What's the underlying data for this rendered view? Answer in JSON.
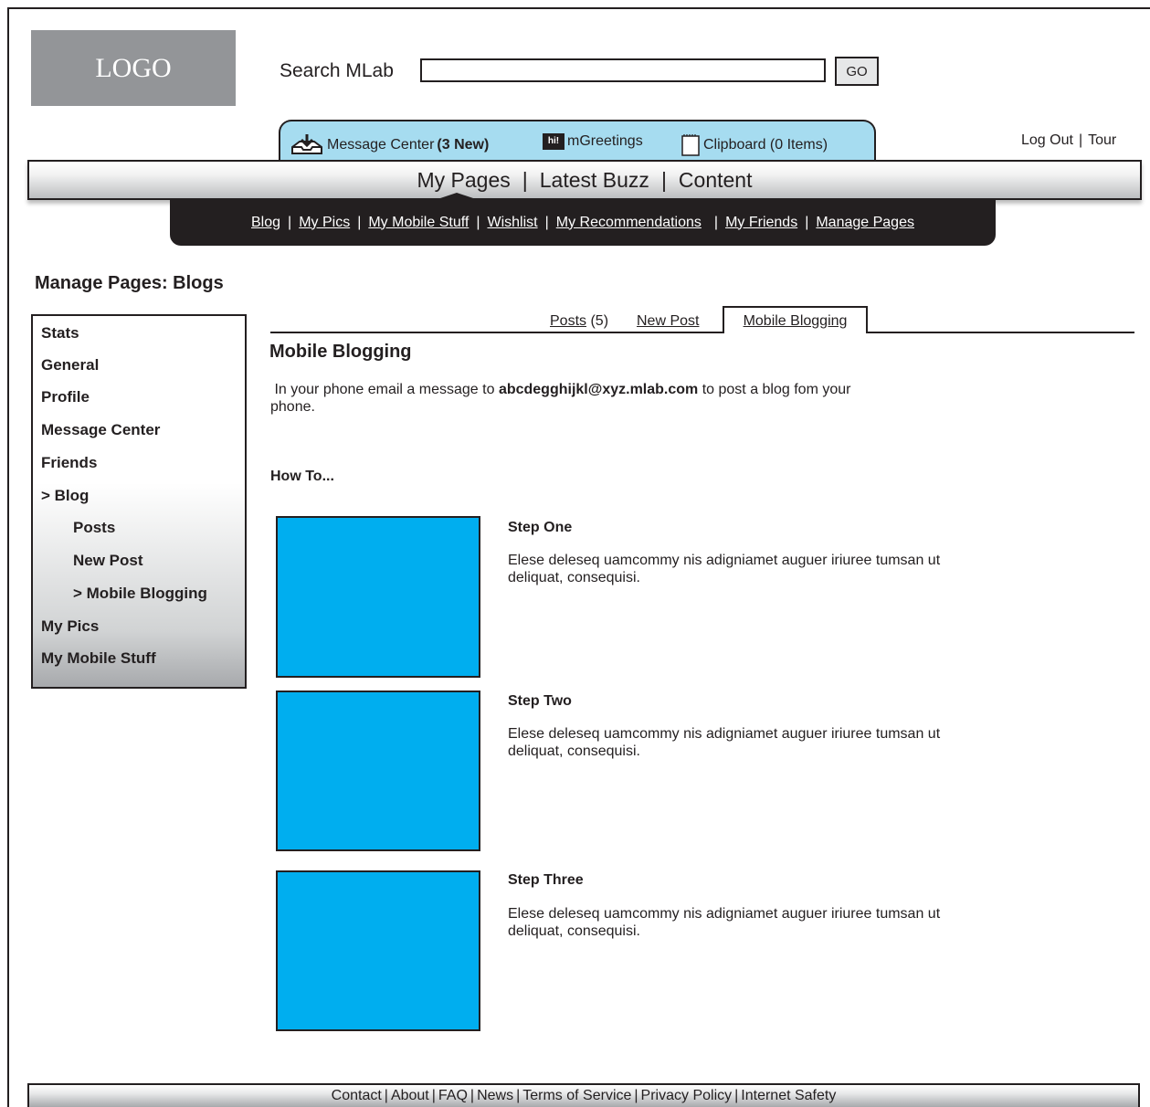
{
  "header": {
    "logo_text": "LOGO",
    "search_label": "Search MLab",
    "search_value": "",
    "go_label": "GO"
  },
  "quickbar": {
    "message_center": "Message Center",
    "message_center_new": "(3 New)",
    "mgreetings": "mGreetings",
    "mgreetings_icon_text": "hi!",
    "clipboard": "Clipboard (0 Items)"
  },
  "top_links": {
    "logout": "Log Out",
    "sep": "|",
    "tour": "Tour"
  },
  "main_nav": {
    "items": [
      "My Pages",
      "Latest Buzz",
      "Content"
    ],
    "sep": "|"
  },
  "sub_nav": {
    "items": [
      "Blog",
      "My Pics",
      "My Mobile Stuff",
      "Wishlist",
      "My Recommendations",
      "My Friends",
      "Manage Pages"
    ],
    "sep": "|"
  },
  "page_heading": "Manage Pages: Blogs",
  "sidebar": {
    "items": [
      "Stats",
      "General",
      "Profile",
      "Message Center",
      "Friends",
      "> Blog",
      "Posts",
      "New Post",
      "> Mobile Blogging",
      "My Pics",
      "My Mobile Stuff"
    ]
  },
  "tabs": {
    "posts": "Posts",
    "posts_count": "(5)",
    "new_post": "New Post",
    "mobile_blogging": "Mobile Blogging"
  },
  "content": {
    "title": "Mobile Blogging",
    "intro_prefix": "In your phone email a message to ",
    "intro_email": "abcdegghijkl@xyz.mlab.com",
    "intro_suffix": " to post a blog fom your phone.",
    "howto": "How To...",
    "steps": [
      {
        "title": "Step One",
        "text": "Elese deleseq uamcommy nis adigniamet auguer iriuree tumsan ut deliquat, consequisi."
      },
      {
        "title": "Step Two",
        "text": "Elese deleseq uamcommy nis adigniamet auguer iriuree tumsan ut deliquat, consequisi."
      },
      {
        "title": "Step Three",
        "text": "Elese deleseq uamcommy nis adigniamet auguer iriuree tumsan ut deliquat, consequisi."
      }
    ]
  },
  "footer": {
    "links": [
      "Contact",
      "About",
      "FAQ",
      "News",
      "Terms of Service",
      "Privacy Policy",
      "Internet Safety"
    ],
    "sep": "|"
  },
  "colors": {
    "accent_blue": "#00aeef",
    "quickbar_blue": "#a6dcf0",
    "dark": "#231f20",
    "logo_gray": "#939598"
  }
}
